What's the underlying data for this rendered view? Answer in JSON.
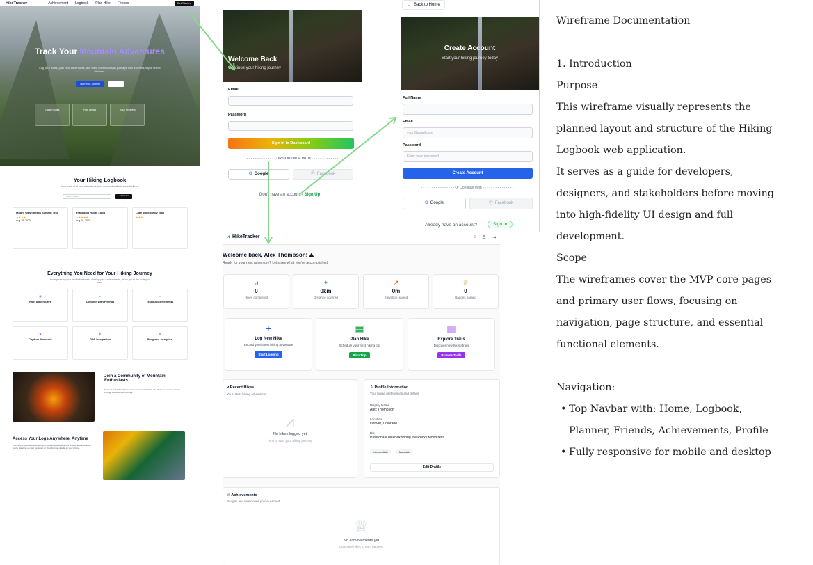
{
  "landing": {
    "nav": {
      "logo": "HikeTracker",
      "items": [
        "Achievement",
        "Logbook",
        "Plan Hike",
        "Friends"
      ],
      "cta": "Get Started"
    },
    "hero": {
      "title_plain": "Track Your ",
      "title_accent": "Mountain Adventures",
      "subtitle": "Log your hikes, plan new adventures, and track your mountain journeys with a community of fellow climbers.",
      "primary_btn": "Start Your Journey",
      "features": [
        "Track Routes",
        "Plan Ahead",
        "Track Progress"
      ]
    },
    "logbook": {
      "title": "Your Hiking Logbook",
      "subtitle": "Keep track of all your adventures, from weekend walks to summit climbs.",
      "search_placeholder": "Search hikes...",
      "add_btn": "+ Add Hike",
      "cards": [
        {
          "name": "Mount Washington Summit Trail",
          "date": "Aug 15, 2023"
        },
        {
          "name": "Franconia Ridge Loop",
          "date": "Aug 10, 2023"
        },
        {
          "name": "Lake Willoughby Trail",
          "date": ""
        }
      ]
    },
    "features": {
      "title": "Everything You Need for Your Hiking Journey",
      "subtitle": "From planning your next adventure to sharing your achievements, we've got all the tools you need.",
      "items": [
        "Plan Adventures",
        "Connect with Friends",
        "Track Achievements",
        "Capture Moments",
        "GPS Integration",
        "Progress Analytics"
      ]
    },
    "community": {
      "title": "Join a Community of Mountain Enthusiasts",
      "text": "Connect with fellow hikers, share your favorite trails, and discover new adventures through our vibrant community."
    },
    "access": {
      "title": "Access Your Logs Anywhere, Anytime",
      "text": "Your hiking logbook travels with you. Access your adventures on any device, whether you're planning on your computer or checking trail details on your phone."
    }
  },
  "login": {
    "title": "Welcome Back",
    "subtitle": "Continue your hiking journey",
    "email_label": "Email",
    "password_label": "Password",
    "submit": "Sign In to Dashboard",
    "divider": "OR CONTINUE WITH",
    "google": "Google",
    "facebook": "Facebook",
    "no_account": "Don't have an account?",
    "signup": "Sign Up"
  },
  "create": {
    "back": "Back to Home",
    "title": "Create Account",
    "subtitle": "Start your hiking journey today",
    "fullname_label": "Full Name",
    "email_label": "Email",
    "email_placeholder": "your@gmail.com",
    "password_label": "Password",
    "password_placeholder": "Enter your password",
    "submit": "Create Account",
    "divider": "Or Continue With",
    "google": "Google",
    "facebook": "Facebook",
    "have_account": "Already have an account?",
    "signin": "Sign In"
  },
  "dashboard": {
    "brand": "HikeTracker",
    "welcome": "Welcome back, Alex Thompson! ⛰",
    "welcome_sub": "Ready for your next adventure? Let's see what you've accomplished.",
    "stats": [
      {
        "value": "0",
        "label": "Hikes completed"
      },
      {
        "value": "0km",
        "label": "Distance covered"
      },
      {
        "value": "0m",
        "label": "Elevation gained"
      },
      {
        "value": "0",
        "label": "Badges earned"
      }
    ],
    "actions": [
      {
        "title": "Log New Hike",
        "sub": "Record your latest hiking adventure",
        "btn": "Start Logging",
        "color": "#2563eb"
      },
      {
        "title": "Plan Hike",
        "sub": "Schedule your next hiking trip",
        "btn": "Plan Trip",
        "color": "#16a34a"
      },
      {
        "title": "Explore Trails",
        "sub": "Discover new hiking trails",
        "btn": "Browse Trails",
        "color": "#9333ea"
      }
    ],
    "recent": {
      "title": "Recent Hikes",
      "sub": "Your latest hiking adventures",
      "empty": "No hikes logged yet",
      "empty_sub": "Time to start your hiking journey!"
    },
    "profile": {
      "title": "Profile Information",
      "sub": "Your hiking preferences and details",
      "name_label": "Display Name",
      "name": "Alex Thompson",
      "loc_label": "Location",
      "loc": "Denver, Colorado",
      "bio_label": "Bio",
      "bio": "Passionate hiker exploring the Rocky Mountains",
      "tags": [
        "Intermediate",
        "Mountain"
      ],
      "edit": "Edit Profile"
    },
    "achievements": {
      "title": "Achievements",
      "sub": "Badges and milestones you've earned",
      "empty": "No achievements yet",
      "empty_sub": "Complete hikes to earn badges!"
    }
  },
  "doc": {
    "title": "Wireframe Documentation",
    "section1": "1. Introduction",
    "purpose": "Purpose",
    "purpose_lines": [
      " This wireframe visually represents the",
      "planned layout and structure of the Hiking",
      "Logbook web application.",
      " It serves as a guide for developers,",
      "designers, and stakeholders before moving",
      "into high-fidelity UI design and full",
      "development."
    ],
    "scope": "Scope",
    "scope_lines": [
      " The wireframes cover the MVP core pages",
      "and primary user flows, focusing on",
      "navigation, page structure, and essential",
      "functional elements."
    ],
    "navigation": "Navigation:",
    "nav_bullet1_a": "Top Navbar with: Home, Logbook,",
    "nav_bullet1_b": "Planner, Friends, Achievements, Profile",
    "nav_bullet2": "Fully responsive for mobile and desktop"
  }
}
